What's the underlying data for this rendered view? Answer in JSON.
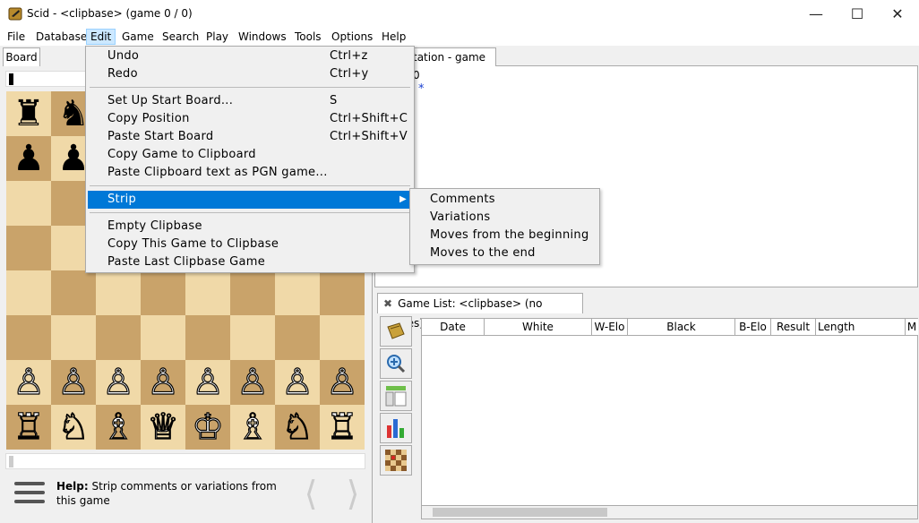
{
  "window": {
    "title": "Scid - <clipbase> (game 0 / 0)",
    "controls": {
      "minimize": "—",
      "maximize": "☐",
      "close": "✕"
    }
  },
  "menubar": [
    "File",
    "Database",
    "Edit",
    "Game",
    "Search",
    "Play",
    "Windows",
    "Tools",
    "Options",
    "Help"
  ],
  "board_panel": {
    "tab": "Board",
    "help_label": "Help:",
    "help_text": "Strip comments or variations from this game",
    "nav_prev": "⟨",
    "nav_next": "⟩"
  },
  "board": {
    "rank8": [
      "♜",
      "♞",
      "",
      "",
      "",
      "",
      "",
      ""
    ],
    "rank7": [
      "♟",
      "♟",
      "",
      "",
      "",
      "",
      "",
      ""
    ],
    "rank2": [
      "♙",
      "♙",
      "♙",
      "♙",
      "♙",
      "♙",
      "♙",
      "♙"
    ],
    "rank1": [
      "♖",
      "♘",
      "♗",
      "♕",
      "♔",
      "♗",
      "♘",
      "♖"
    ]
  },
  "notation": {
    "tab": "tation - game 0",
    "content": "*"
  },
  "gamelist": {
    "tab_close": "✖",
    "tab": "Game List: <clipbase> (no games)",
    "columns": [
      "Date",
      "White",
      "W-Elo",
      "Black",
      "B-Elo",
      "Result",
      "Length",
      "M"
    ]
  },
  "edit_menu": {
    "items": [
      {
        "label": "Undo",
        "shortcut": "Ctrl+z"
      },
      {
        "label": "Redo",
        "shortcut": "Ctrl+y"
      },
      {
        "label": "Set Up Start Board...",
        "shortcut": "S"
      },
      {
        "label": "Copy Position",
        "shortcut": "Ctrl+Shift+C"
      },
      {
        "label": "Paste Start Board",
        "shortcut": "Ctrl+Shift+V"
      },
      {
        "label": "Copy Game to Clipboard",
        "shortcut": ""
      },
      {
        "label": "Paste Clipboard text as PGN game...",
        "shortcut": ""
      },
      {
        "label": "Strip",
        "shortcut": ""
      },
      {
        "label": "Empty Clipbase",
        "shortcut": ""
      },
      {
        "label": "Copy This Game to Clipbase",
        "shortcut": ""
      },
      {
        "label": "Paste Last Clipbase Game",
        "shortcut": ""
      }
    ]
  },
  "strip_submenu": [
    "Comments",
    "Variations",
    "Moves from the beginning",
    "Moves to the end"
  ],
  "colors": {
    "highlight": "#0078d7",
    "light_square": "#f0d9a8",
    "dark_square": "#c9a36a"
  }
}
